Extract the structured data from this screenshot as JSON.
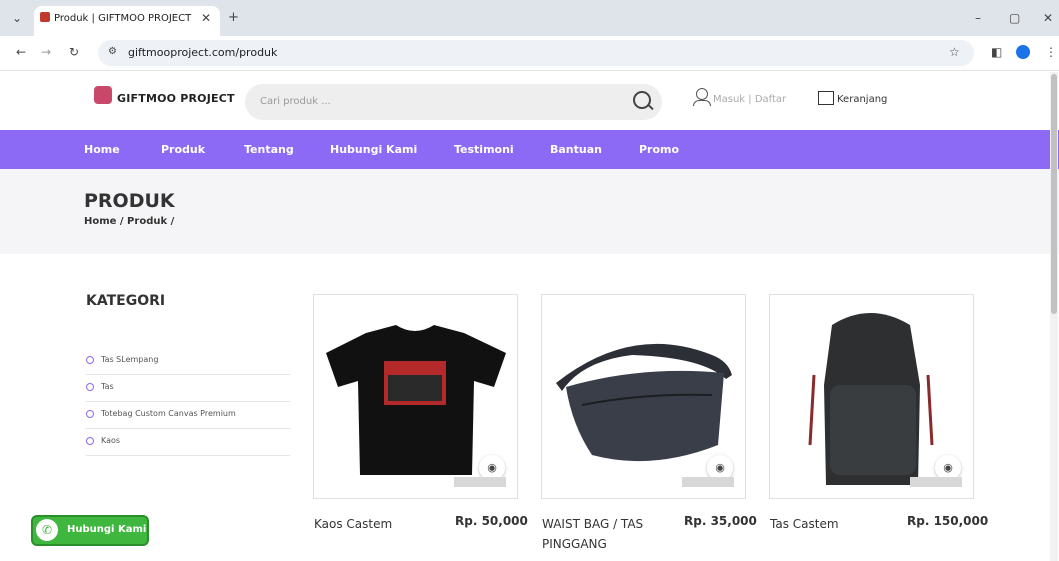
{
  "browser": {
    "tab_title": "Produk | GIFTMOO PROJECT",
    "url": "giftmooproject.com/produk"
  },
  "header": {
    "logo_text": "GIFTMOO PROJECT",
    "search_placeholder": "Cari produk ...",
    "login": "Masuk | Daftar",
    "cart": "Keranjang"
  },
  "nav": [
    {
      "label": "Home"
    },
    {
      "label": "Produk"
    },
    {
      "label": "Tentang"
    },
    {
      "label": "Hubungi Kami"
    },
    {
      "label": "Testimoni"
    },
    {
      "label": "Bantuan"
    },
    {
      "label": "Promo"
    }
  ],
  "banner": {
    "title": "PRODUK",
    "breadcrumb": "Home / Produk /"
  },
  "categories": {
    "title": "KATEGORI",
    "items": [
      {
        "label": "Tas SLempang"
      },
      {
        "label": "Tas"
      },
      {
        "label": "Totebag Custom Canvas Premium"
      },
      {
        "label": "Kaos"
      }
    ]
  },
  "products": [
    {
      "name": "Kaos Castem",
      "price": "Rp. 50,000"
    },
    {
      "name": "WAIST BAG / TAS PINGGANG",
      "price": "Rp. 35,000"
    },
    {
      "name": "Tas Castem",
      "price": "Rp. 150,000"
    }
  ],
  "whatsapp": {
    "label": "Hubungi Kami"
  },
  "colors": {
    "accent": "#8c6af6",
    "whatsapp": "#3fb73f"
  }
}
